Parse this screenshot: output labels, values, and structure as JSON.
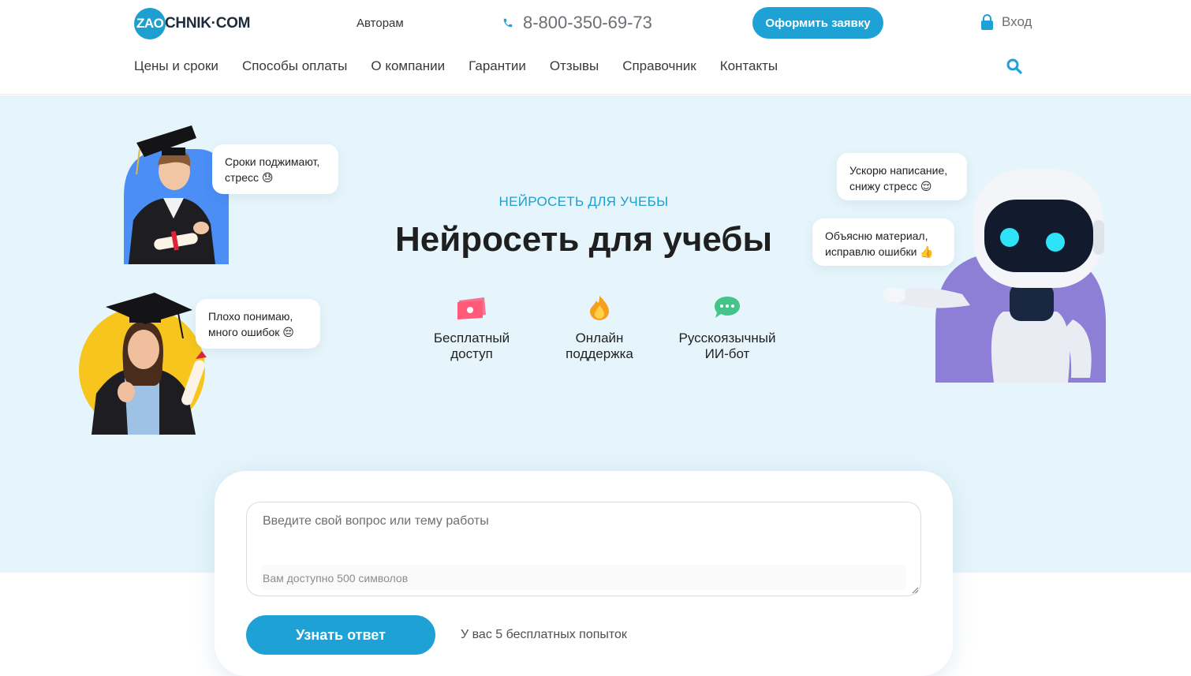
{
  "header": {
    "logo_badge": "ZAO",
    "logo_text": "CHNIK·COM",
    "authors_link": "Авторам",
    "phone": "8-800-350-69-73",
    "cta_label": "Оформить заявку",
    "login_label": "Вход"
  },
  "nav": {
    "items": [
      "Цены и сроки",
      "Способы оплаты",
      "О компании",
      "Гарантии",
      "Отзывы",
      "Справочник",
      "Контакты"
    ]
  },
  "hero": {
    "eyebrow": "НЕЙРОСЕТЬ ДЛЯ УЧЕБЫ",
    "title": "Нейросеть для учебы",
    "features": [
      {
        "line1": "Бесплатный",
        "line2": "доступ",
        "icon": "money-icon"
      },
      {
        "line1": "Онлайн",
        "line2": "поддержка",
        "icon": "fire-icon"
      },
      {
        "line1": "Русскоязычный",
        "line2": "ИИ-бот",
        "icon": "chat-icon"
      }
    ],
    "bubbles": {
      "student_boy_l1": "Сроки поджимают,",
      "student_boy_l2": "стресс 😓",
      "student_girl_l1": "Плохо понимаю,",
      "student_girl_l2": "много ошибок 😔",
      "robot_top_l1": "Ускорю написание,",
      "robot_top_l2": "снижу стресс 😌",
      "robot_mid_l1": "Объясню материал,",
      "robot_mid_l2": "исправлю ошибки 👍"
    }
  },
  "form": {
    "placeholder": "Введите свой вопрос или тему работы",
    "char_hint": "Вам доступно 500 символов",
    "submit_label": "Узнать ответ",
    "attempts_text": "У вас 5 бесплатных попыток"
  },
  "colors": {
    "accent": "#1ea2d6",
    "hero_bg": "#e6f5fb",
    "purple": "#8d7fd6",
    "yellow": "#f7c51e",
    "blue_circle": "#4b8ef5"
  }
}
